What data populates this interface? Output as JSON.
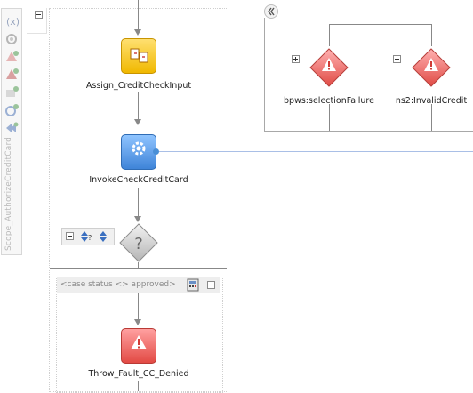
{
  "scope": {
    "name": "Scope_AuthorizeCreditCard",
    "tools": [
      "variables-icon",
      "correlation-icon",
      "gear-icon",
      "catch-icon",
      "catch-all-icon",
      "compensation-icon",
      "event-icon",
      "terminate-icon"
    ]
  },
  "activities": {
    "assign": {
      "label": "Assign_CreditCheckInput",
      "icon": "assign-icon",
      "color": "#f4c430"
    },
    "invoke": {
      "label": "InvokeCheckCreditCard",
      "icon": "gear-icon",
      "color": "#4a8fd6"
    },
    "switch": {
      "icon": "question-icon"
    },
    "throw": {
      "label": "Throw_Fault_CC_Denied",
      "icon": "warning-icon",
      "color": "#e8504a"
    }
  },
  "case": {
    "condition": "<case status <> approved>"
  },
  "faults": [
    {
      "label": "bpws:selectionFailure",
      "icon": "warning-icon"
    },
    {
      "label": "ns2:InvalidCredit",
      "icon": "warning-icon"
    }
  ],
  "colors": {
    "link": "#8fa8d8",
    "warning": "#e35a55"
  }
}
